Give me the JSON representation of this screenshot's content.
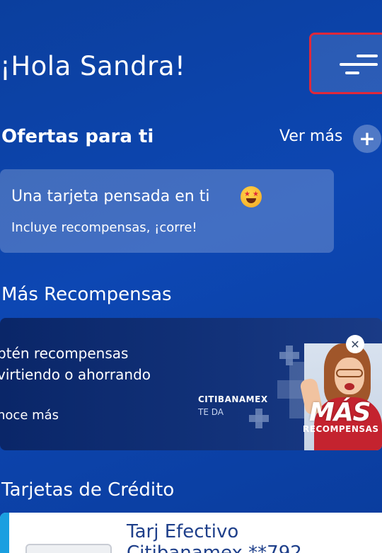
{
  "header": {
    "greeting": "¡Hola Sandra!",
    "menu_icon": "hamburger-menu-icon"
  },
  "ofertas": {
    "title": "Ofertas para ti",
    "ver_mas_label": "Ver más",
    "plus_icon": "plus-icon",
    "card": {
      "title": "Una tarjeta pensada en ti",
      "emoji": "star-struck-emoji",
      "subtitle": "Incluye recompensas, ¡corre!"
    }
  },
  "recompensas": {
    "title": "Más Recompensas",
    "banner": {
      "line1": "btén recompensas",
      "line2": "virtiendo o ahorrando",
      "cta": "noce más",
      "brand_top": "CITIBANAMEX",
      "brand_bottom": "TE DA",
      "headline": "MÁS",
      "headline_sub": "RECOMPENSAS",
      "close_icon": "close-icon"
    }
  },
  "tarjetas": {
    "title": "Tarjetas de Crédito",
    "card": {
      "name_line1": "Tarj Efectivo",
      "name_line2": "Citibanamex **792"
    }
  },
  "colors": {
    "background": "#0d47b3",
    "highlight_border": "#e0283a",
    "card_accent": "#1a9fe0"
  }
}
